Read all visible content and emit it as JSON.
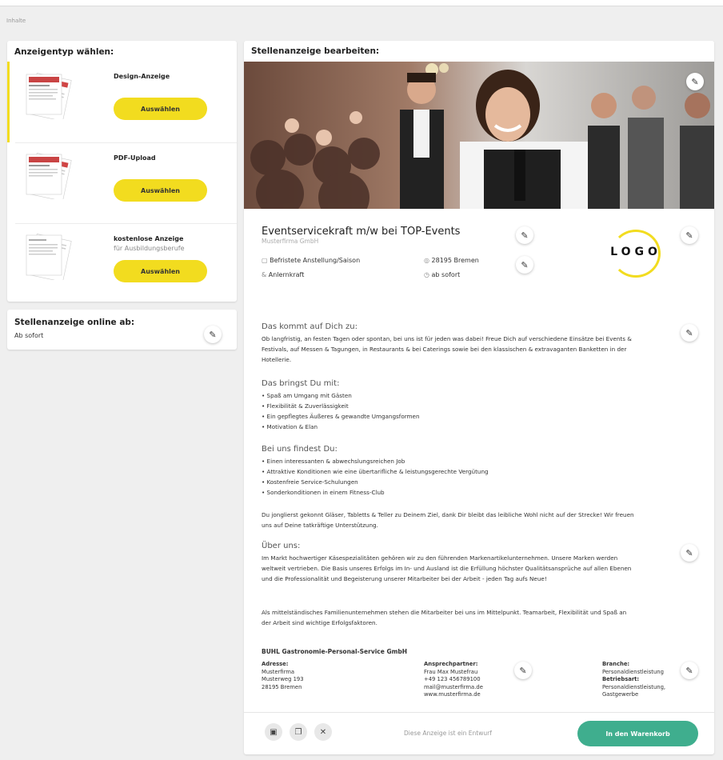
{
  "breadcrumb": "Inhalte",
  "left_panel": {
    "title": "Anzeigentyp wählen:",
    "types": [
      {
        "name": "Design-Anzeige",
        "sub": "",
        "button": "Auswählen"
      },
      {
        "name": "PDF-Upload",
        "sub": "",
        "button": "Auswählen"
      },
      {
        "name": "kostenlose Anzeige",
        "sub": "für Ausbildungsberufe",
        "button": "Auswählen"
      }
    ]
  },
  "online_panel": {
    "title": "Stellenanzeige online ab:",
    "value": "Ab sofort"
  },
  "editor": {
    "title": "Stellenanzeige bearbeiten:",
    "logo_text": "LOGO",
    "job_title": "Eventservicekraft m/w bei TOP-Events",
    "company_sub": "Musterfirma GmbH",
    "meta": {
      "employment": "Befristete Anstellung/Saison",
      "location": "28195 Bremen",
      "position": "Anlernkraft",
      "start": "ab sofort"
    },
    "sections": {
      "s1_heading": "Das kommt auf Dich zu:",
      "s1_text": "Ob langfristig, an festen Tagen oder spontan, bei uns ist für jeden was dabei! Freue Dich auf verschiedene Einsätze bei Events & Festivals, auf Messen & Tagungen, in Restaurants & bei Caterings sowie bei den klassischen & extravaganten Banketten in der Hotellerie.",
      "s2_heading": "Das bringst Du mit:",
      "s2_items": [
        "Spaß am Umgang mit Gästen",
        "Flexibilität & Zuverlässigkeit",
        "Ein gepflegtes Äußeres & gewandte Umgangsformen",
        "Motivation & Elan"
      ],
      "s3_heading": "Bei uns findest Du:",
      "s3_items": [
        "Einen interessanten & abwechslungsreichen Job",
        "Attraktive Konditionen wie eine übertarifliche & leistungsgerechte Vergütung",
        "Kostenfreie Service-Schulungen",
        "Sonderkonditionen in einem Fitness-Club"
      ],
      "s3_text": "Du jonglierst gekonnt Gläser, Tabletts & Teller zu Deinem Ziel, dank Dir bleibt das leibliche Wohl nicht auf der Strecke! Wir freuen uns auf Deine tatkräftige Unterstützung.",
      "s4_heading": "Über uns:",
      "s4_text": "Im Markt hochwertiger Käsespezialitäten gehören wir zu den führenden Markenartikelunternehmen. Unsere Marken werden weltweit vertrieben. Die Basis unseres Erfolgs im In- und Ausland ist die Erfüllung höchster Qualitätsansprüche auf allen Ebenen und die Professionalität und Begeisterung unserer Mitarbeiter bei der Arbeit - jeden Tag aufs Neue!",
      "s4_text2": "Als mittelständisches Familienunternehmen stehen die Mitarbeiter bei uns im Mittelpunkt. Teamarbeit, Flexibilität und Spaß an der Arbeit sind wichtige Erfolgsfaktoren."
    },
    "footer_info": {
      "company": "BUHL Gastronomie-Personal-Service GmbH",
      "address_label": "Adresse:",
      "address_lines": [
        "Musterfirma",
        "Musterweg 193",
        "28195 Bremen"
      ],
      "contact_label": "Ansprechpartner:",
      "contact_lines": [
        "Frau Max Mustefrau",
        "+49 123 456789100",
        "mail@musterfirma.de",
        "www.musterfirma.de"
      ],
      "branch_label": "Branche:",
      "branch_value": "Personaldienstleistung",
      "type_label": "Betriebsart:",
      "type_lines": [
        "Personaldienstleistung,",
        "Gastgewerbe"
      ]
    },
    "bottom": {
      "hint": "Diese Anzeige ist ein Entwurf",
      "cart_button": "In den Warenkorb"
    }
  }
}
